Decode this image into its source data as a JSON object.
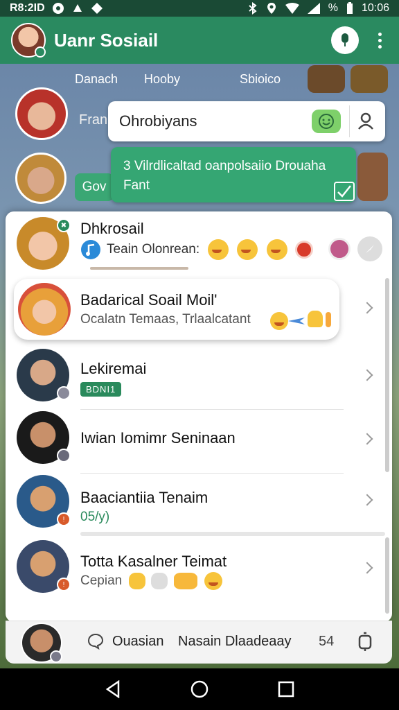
{
  "status": {
    "time": "R8:2ID",
    "battery": "%",
    "clock": "10:06"
  },
  "app": {
    "title": "Uanr Sosiail"
  },
  "background": {
    "tabs": [
      "Danach",
      "Hooby",
      "Sbioico"
    ],
    "side_label": "Fran",
    "mini_bubble": "Gov"
  },
  "overlay": {
    "search_text": "Ohrobiyans",
    "message": "3 Vilrdlicaltad oanpolsaiio Drouaha Fant"
  },
  "list": [
    {
      "name": "Dhkrosail",
      "sub": "Teain Olonrean:"
    },
    {
      "name": "Badarical Soail Moil'",
      "sub": "Ocalatn Temaas,  Trlaalcatant"
    },
    {
      "name": "Lekiremai",
      "tag": "BDNI1"
    },
    {
      "name": "Iwian Iomimr Seninaan"
    },
    {
      "name": "Baaciantiia Tenaim",
      "sub": "05/y)"
    },
    {
      "name": "Totta Kasalner Teimat",
      "sub": "Cepian"
    }
  ],
  "bottom_bar": {
    "label1": "Ouasian",
    "label2": "Nasain Dlaadeaay",
    "count": "54"
  }
}
